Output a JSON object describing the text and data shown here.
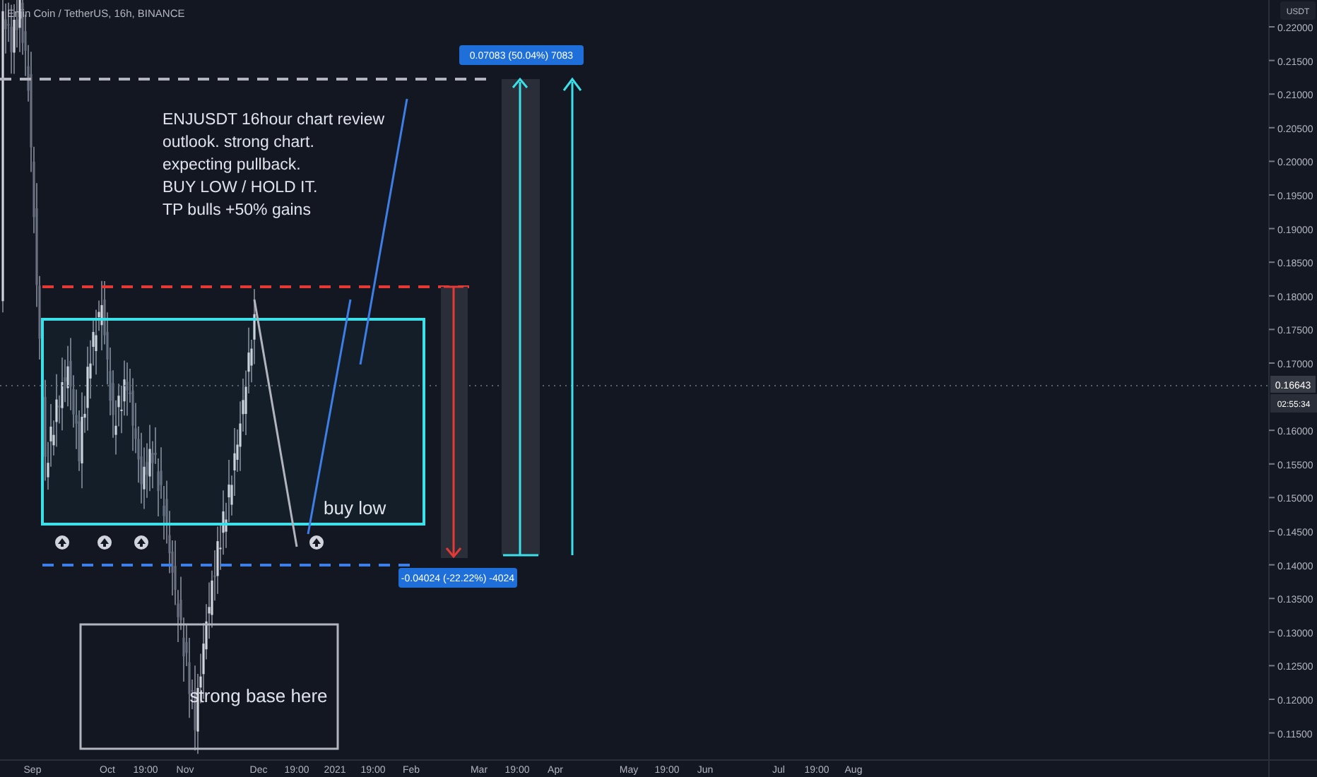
{
  "header": {
    "symbol": "Enjin Coin / TetherUS, 16h, BINANCE"
  },
  "price_axis": {
    "unit": "USDT",
    "ticks": [
      "0.22000",
      "0.21500",
      "0.21000",
      "0.20500",
      "0.20000",
      "0.19500",
      "0.19000",
      "0.18500",
      "0.18000",
      "0.17500",
      "0.17000",
      "0.16000",
      "0.15500",
      "0.15000",
      "0.14500",
      "0.14000",
      "0.13500",
      "0.13000",
      "0.12500",
      "0.12000",
      "0.11500"
    ],
    "last_price": "0.16643",
    "countdown": "02:55:34"
  },
  "time_axis": {
    "labels": [
      "Sep",
      "Oct",
      "19:00",
      "Nov",
      "Dec",
      "19:00",
      "2021",
      "19:00",
      "Feb",
      "Mar",
      "19:00",
      "Apr",
      "May",
      "19:00",
      "Jun",
      "Jul",
      "19:00",
      "Aug"
    ]
  },
  "chart_note": {
    "lines": [
      "ENJUSDT 16hour chart review",
      "outlook. strong chart.",
      "expecting pullback.",
      "BUY LOW / HOLD IT.",
      "TP bulls +50% gains"
    ]
  },
  "zones": [
    {
      "kind": "buy",
      "label": "buy low"
    },
    {
      "kind": "base",
      "label": "strong base here"
    }
  ],
  "measurements": [
    {
      "kind": "up",
      "label": "0.07083 (50.04%) 7083"
    },
    {
      "kind": "down",
      "label": "-0.04024 (-22.22%) -4024"
    }
  ]
}
